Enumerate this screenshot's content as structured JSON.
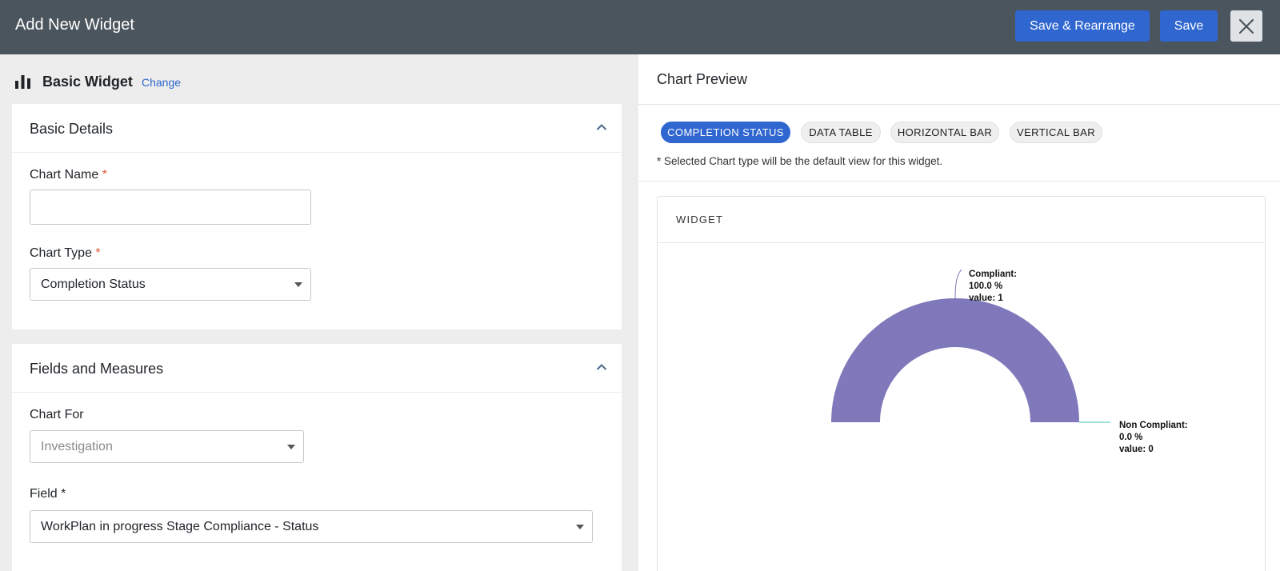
{
  "header": {
    "title": "Add New Widget",
    "save_rearrange_label": "Save & Rearrange",
    "save_label": "Save"
  },
  "widget_type": {
    "title": "Basic Widget",
    "change_label": "Change"
  },
  "basic_details": {
    "title": "Basic Details",
    "chart_name_label": "Chart Name",
    "chart_name_value": "",
    "chart_type_label": "Chart Type",
    "chart_type_value": "Completion Status",
    "required_mark": "*"
  },
  "fields_measures": {
    "title": "Fields and Measures",
    "chart_for_label": "Chart For",
    "chart_for_value": "Investigation",
    "field_label": "Field *",
    "field_value": "WorkPlan in progress Stage Compliance - Status"
  },
  "preview": {
    "title": "Chart Preview",
    "chips": [
      "COMPLETION STATUS",
      "DATA TABLE",
      "HORIZONTAL BAR",
      "VERTICAL BAR"
    ],
    "active_chip": "COMPLETION STATUS",
    "note": "* Selected Chart type will be the default view for this widget.",
    "widget_label": "WIDGET"
  },
  "chart_data": {
    "type": "pie",
    "style": "semi-donut",
    "slices": [
      {
        "label_lines": [
          "Compliant:",
          "100.0 %",
          "value: 1"
        ],
        "percent": 100.0,
        "value": 1,
        "color": "#7f78bb"
      },
      {
        "label_lines": [
          "Non Compliant:",
          "0.0 %",
          "value: 0"
        ],
        "percent": 0.0,
        "value": 0,
        "color": "#3cc4b4"
      }
    ]
  },
  "colors": {
    "topbar": "#4b555d",
    "primary": "#2f66d0",
    "required": "#e05a3b"
  }
}
